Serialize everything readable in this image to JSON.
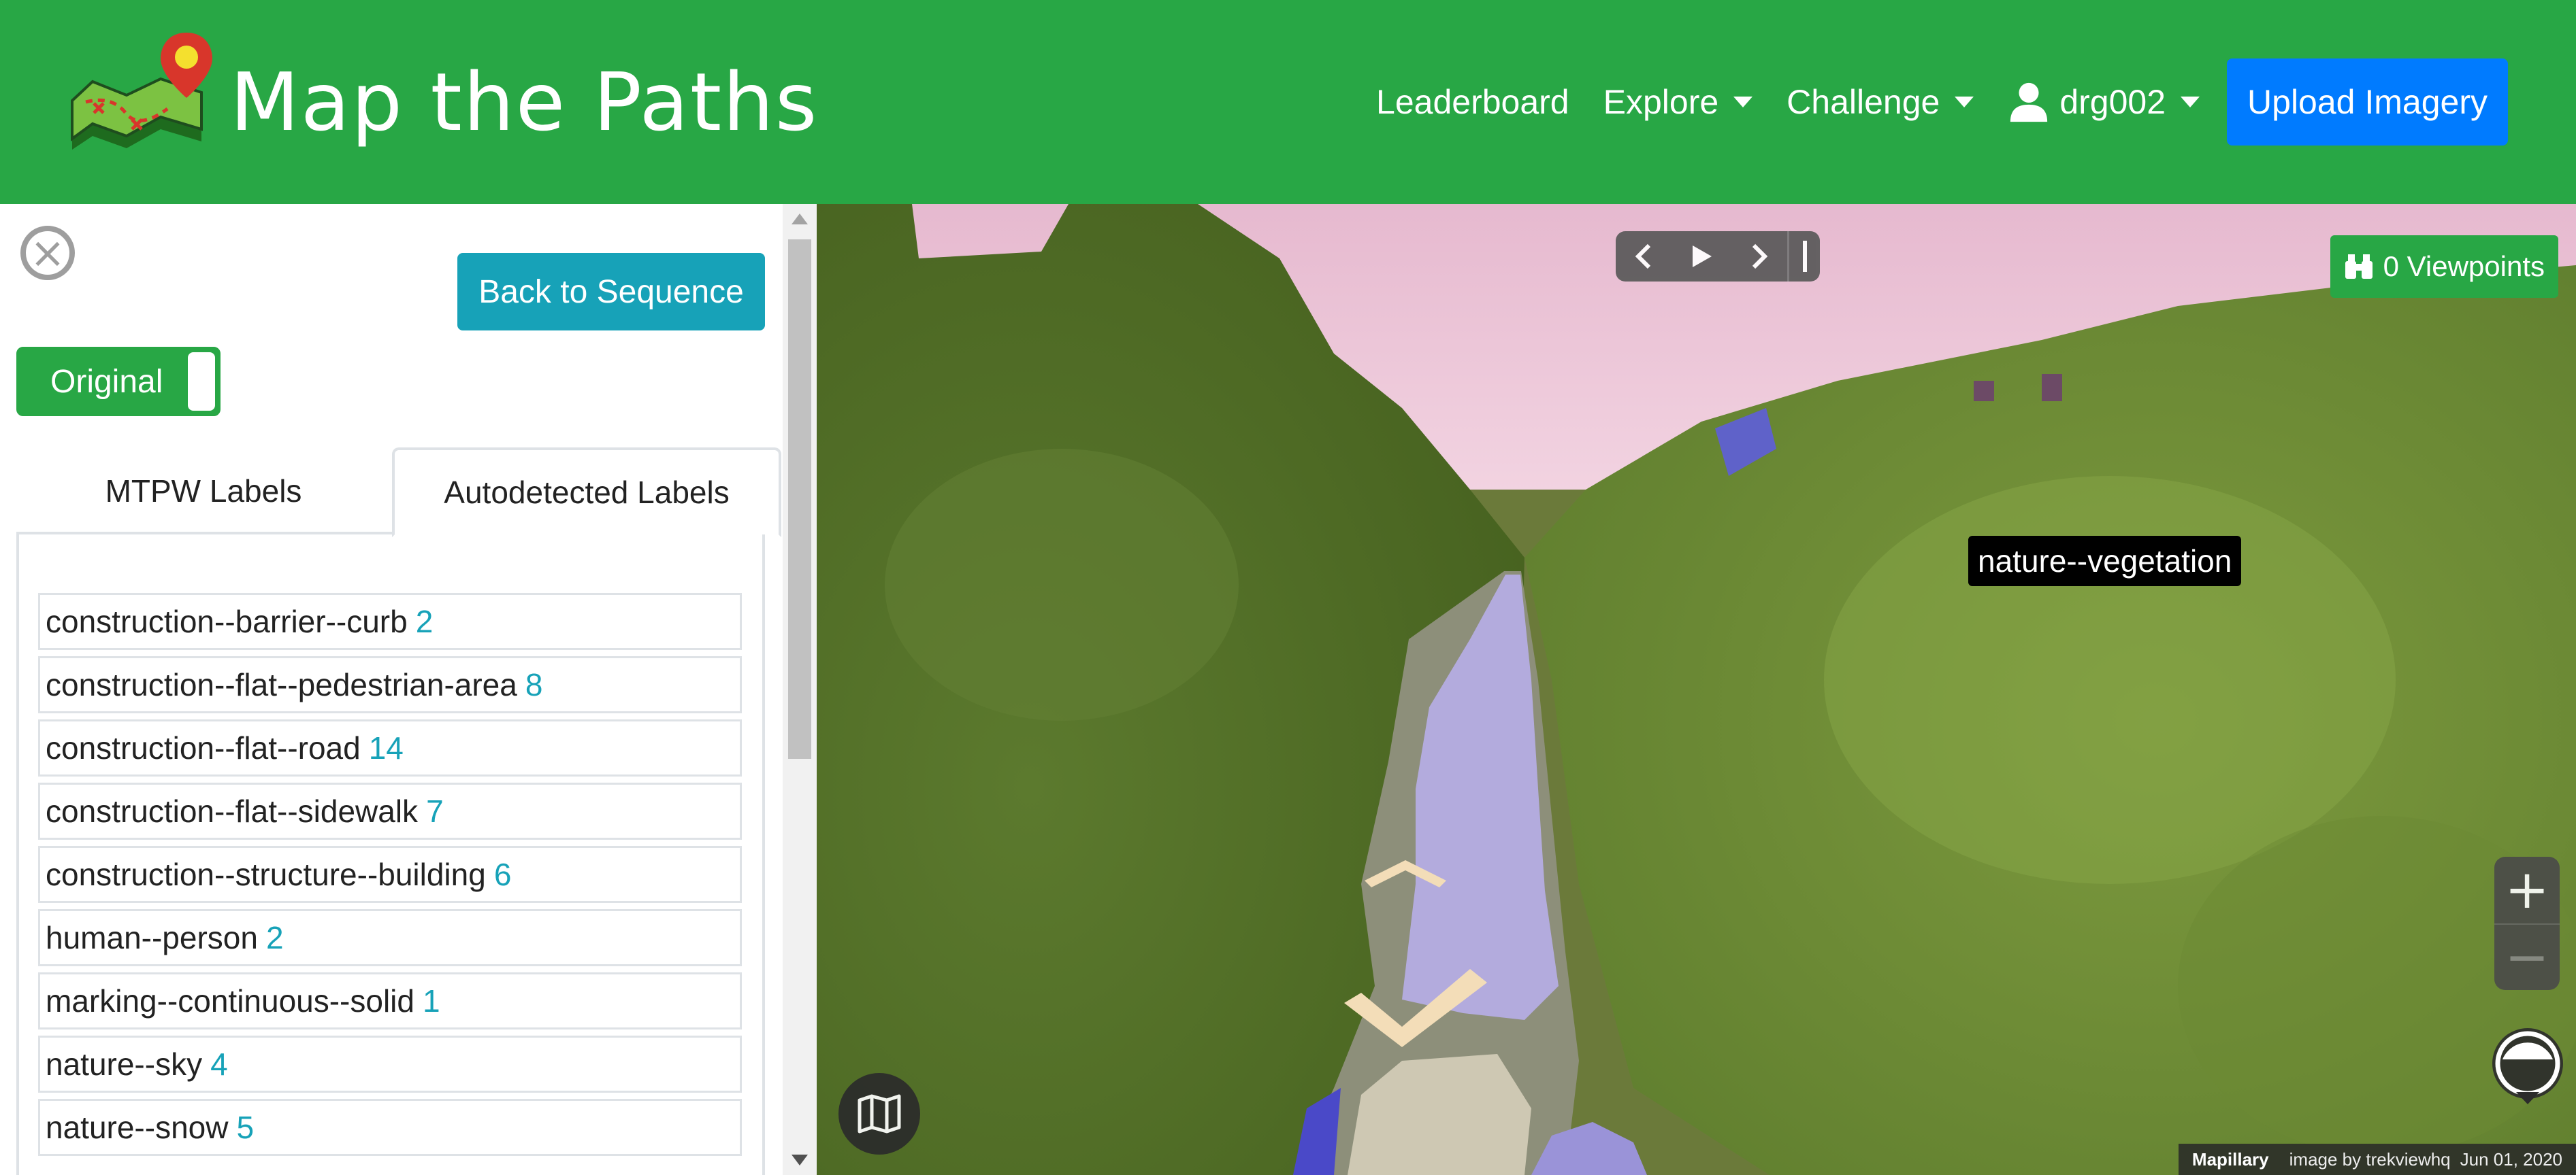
{
  "navbar": {
    "brand_title": "Map the Paths",
    "links": {
      "leaderboard": "Leaderboard",
      "explore": "Explore",
      "challenge": "Challenge",
      "user": "drg002"
    },
    "upload_label": "Upload Imagery",
    "colors": {
      "background": "#28a745",
      "upload": "#007bff"
    }
  },
  "sidebar": {
    "back_label": "Back to Sequence",
    "toggle_label": "Original",
    "tabs": [
      {
        "label": "MTPW Labels"
      },
      {
        "label": "Autodetected Labels"
      }
    ],
    "labels": [
      {
        "name": "construction--barrier--curb",
        "count": "2"
      },
      {
        "name": "construction--flat--pedestrian-area",
        "count": "8"
      },
      {
        "name": "construction--flat--road",
        "count": "14"
      },
      {
        "name": "construction--flat--sidewalk",
        "count": "7"
      },
      {
        "name": "construction--structure--building",
        "count": "6"
      },
      {
        "name": "human--person",
        "count": "2"
      },
      {
        "name": "marking--continuous--solid",
        "count": "1"
      },
      {
        "name": "nature--sky",
        "count": "4"
      },
      {
        "name": "nature--snow",
        "count": "5"
      }
    ]
  },
  "viewer": {
    "viewpoints_label": "0 Viewpoints",
    "tooltip": "nature--vegetation",
    "zoom_in": "+",
    "zoom_out": "−",
    "attribution": {
      "brand": "Mapillary",
      "credit": "image by trekviewhq",
      "date": "Jun 01, 2020"
    }
  }
}
